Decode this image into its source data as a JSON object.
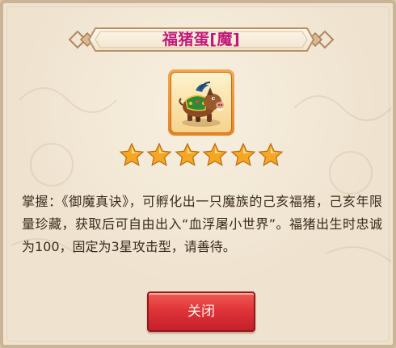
{
  "dialog": {
    "title": "福猪蛋[魔]",
    "item_icon": "boar-pet-icon",
    "star_count": 6,
    "max_stars": 6,
    "description": "掌握：《御魔真诀》，可孵化出一只魔族的己亥福猪，己亥年限量珍藏，获取后可自由出入“血浮屠小世界”。福猪出生时忠诚为100，固定为3星攻击型，请善待。",
    "close_label": "关闭"
  },
  "colors": {
    "title": "#c2187a",
    "star": "#f5a623",
    "close_button": "#e0343a",
    "panel_bg": "#efe3cf",
    "item_frame": "#f09a3e"
  }
}
